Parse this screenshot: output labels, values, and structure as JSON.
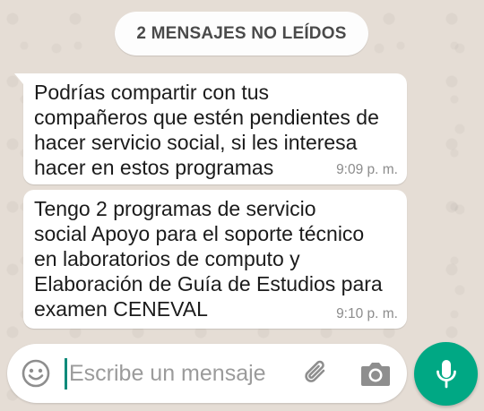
{
  "chat": {
    "unread_banner": "2 MENSAJES NO LEÍDOS",
    "messages": [
      {
        "text": "Podrías compartir con tus\ncompañeros que estén pendientes de\nhacer servicio social, si les interesa\nhacer en estos programas",
        "time": "9:09 p. m."
      },
      {
        "text": "Tengo 2 programas de servicio\nsocial Apoyo para el soporte técnico\nen laboratorios de computo y\nElaboración de Guía de Estudios para\nexamen CENEVAL",
        "time": "9:10 p. m."
      }
    ]
  },
  "composer": {
    "placeholder": "Escribe un mensaje",
    "emoji_icon": "emoji-icon",
    "attach_icon": "paperclip-icon",
    "camera_icon": "camera-icon",
    "mic_icon": "microphone-icon"
  },
  "colors": {
    "background": "#e5ddd5",
    "bubble": "#ffffff",
    "accent": "#00a884",
    "caret": "#0f8a7a"
  }
}
